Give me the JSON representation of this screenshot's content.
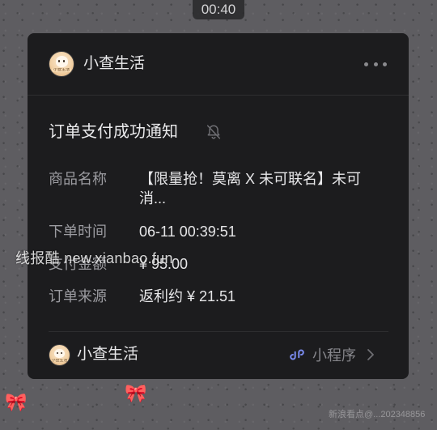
{
  "status_bar": {
    "time": "00:40"
  },
  "card": {
    "brand_name": "小查生活",
    "avatar_text": "小查生活",
    "title": "订单支付成功通知",
    "fields": [
      {
        "label": "商品名称",
        "value": "【限量抢！莫离 X 未可联名】未可消..."
      },
      {
        "label": "下单时间",
        "value": "06-11 00:39:51"
      },
      {
        "label": "支付金额",
        "value": "¥ 95.00"
      },
      {
        "label": "订单来源",
        "value": "返利约 ¥ 21.51"
      }
    ],
    "footer": {
      "brand_name": "小查生活",
      "mini_program_label": "小程序"
    }
  },
  "icons": {
    "more": "more-dots-icon",
    "bell": "bell-muted-icon",
    "mini_program": "mini-program-icon",
    "chevron": "chevron-right-icon"
  },
  "watermarks": {
    "main": "线报酷 new.xianbao.fun",
    "corner": "新浪看点@...202348856"
  },
  "colors": {
    "background": "#5e5d61",
    "card": "#1c1c1e",
    "accent_mini_program": "#7b8cf0"
  }
}
